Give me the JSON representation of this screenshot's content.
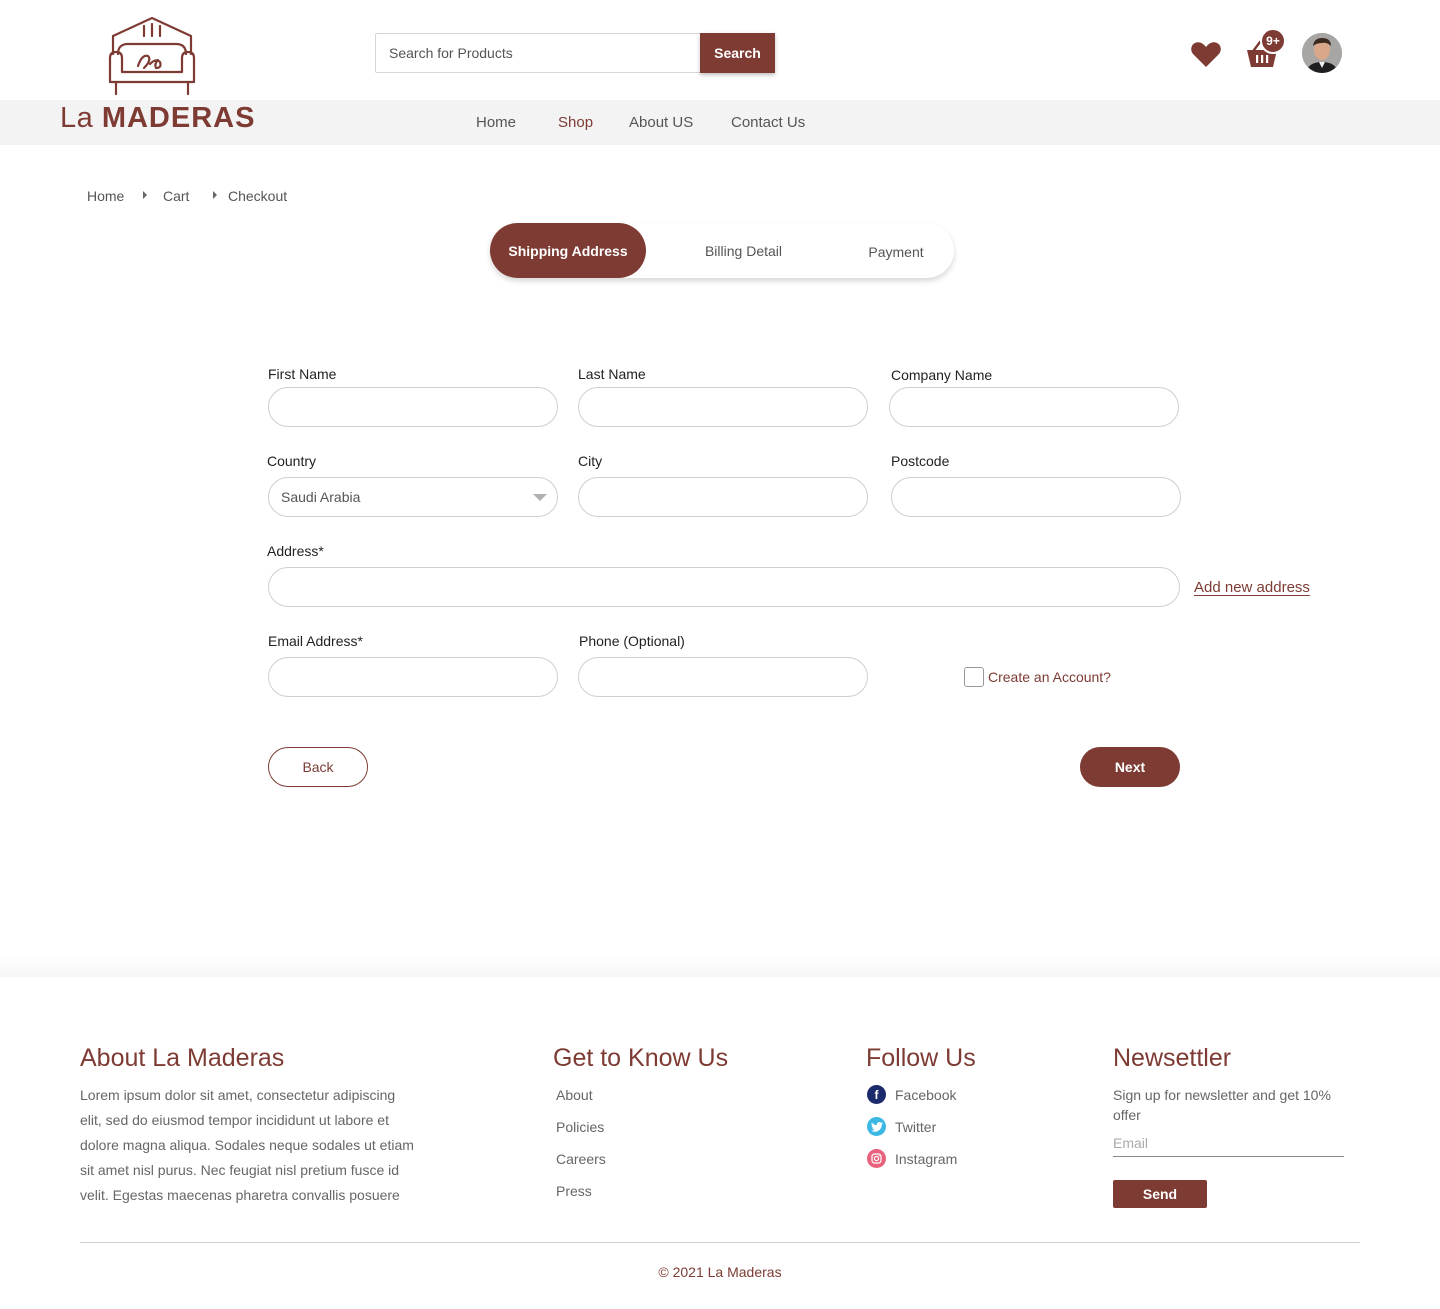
{
  "header": {
    "logo": {
      "light": "La",
      "bold": "MADERAS"
    },
    "search": {
      "placeholder": "Search for Products",
      "button_label": "Search"
    },
    "cart_badge": "9+",
    "nav": [
      {
        "label": "Home",
        "active": false
      },
      {
        "label": "Shop",
        "active": true
      },
      {
        "label": "About US",
        "active": false
      },
      {
        "label": "Contact Us",
        "active": false
      }
    ]
  },
  "breadcrumb": [
    "Home",
    "Cart",
    "Checkout"
  ],
  "steps": [
    {
      "label": "Shipping Address",
      "active": true
    },
    {
      "label": "Billing Detail",
      "active": false
    },
    {
      "label": "Payment",
      "active": false
    }
  ],
  "form": {
    "first_name": {
      "label": "First Name",
      "value": ""
    },
    "last_name": {
      "label": "Last Name",
      "value": ""
    },
    "company_name": {
      "label": "Company Name",
      "value": ""
    },
    "country": {
      "label": "Country",
      "value": "Saudi Arabia"
    },
    "city": {
      "label": "City",
      "value": ""
    },
    "postcode": {
      "label": "Postcode",
      "value": ""
    },
    "address": {
      "label": "Address*",
      "value": ""
    },
    "add_new_address": "Add new address",
    "email": {
      "label": "Email Address*",
      "value": ""
    },
    "phone": {
      "label": "Phone (Optional)",
      "value": ""
    },
    "create_account": {
      "label": "Create an Account?",
      "checked": false
    },
    "back_label": "Back",
    "next_label": "Next"
  },
  "footer": {
    "about": {
      "title": "About La Maderas",
      "text": "Lorem ipsum dolor sit amet, consectetur adipiscing elit, sed do eiusmod tempor incididunt ut labore et dolore magna aliqua. Sodales neque sodales ut etiam sit amet nisl purus. Nec feugiat nisl pretium fusce id velit. Egestas maecenas pharetra convallis posuere"
    },
    "know_us": {
      "title": "Get to Know Us",
      "links": [
        "About",
        "Policies",
        "Careers",
        "Press"
      ]
    },
    "follow": {
      "title": "Follow Us",
      "links": [
        {
          "label": "Facebook",
          "icon": "facebook-icon",
          "color": "#1b2a6b"
        },
        {
          "label": "Twitter",
          "icon": "twitter-icon",
          "color": "#3cb8e4"
        },
        {
          "label": "Instagram",
          "icon": "instagram-icon",
          "color": "#e8627e"
        }
      ]
    },
    "newsletter": {
      "title": "Newsettler",
      "text": "Sign up for newsletter and get 10% offer",
      "placeholder": "Email",
      "send_label": "Send"
    },
    "copyright": "© 2021 La Maderas"
  },
  "colors": {
    "brand": "#7d3b33",
    "nav_bg": "#f3f3f3"
  }
}
